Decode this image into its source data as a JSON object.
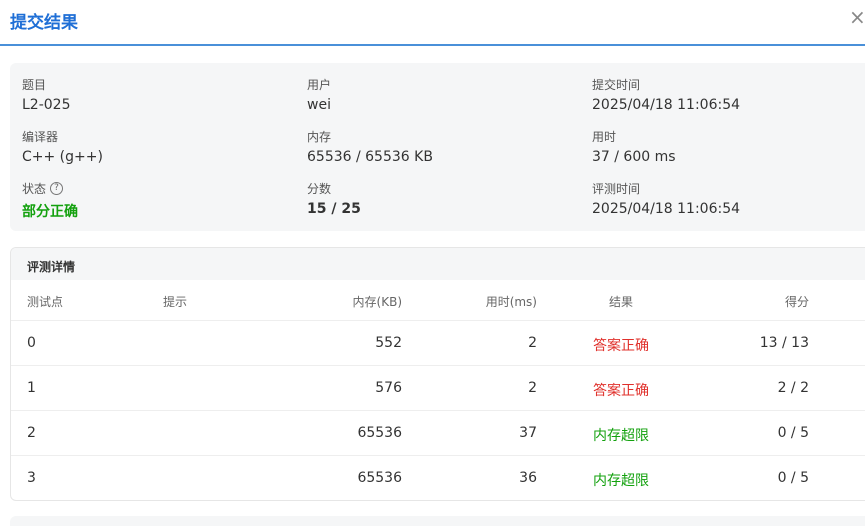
{
  "header": {
    "title": "提交结果",
    "close_glyph": "×"
  },
  "info": {
    "problem_label": "题目",
    "problem": "L2-025",
    "user_label": "用户",
    "user": "wei",
    "submit_time_label": "提交时间",
    "submit_time": "2025/04/18 11:06:54",
    "compiler_label": "编译器",
    "compiler": "C++ (g++)",
    "memory_label": "内存",
    "memory": "65536 / 65536 KB",
    "time_label": "用时",
    "time": "37 / 600 ms",
    "status_label": "状态",
    "status": "部分正确",
    "status_help_icon": "question-circle-icon",
    "score_label": "分数",
    "score": "15 / 25",
    "judge_time_label": "评测时间",
    "judge_time": "2025/04/18 11:06:54"
  },
  "details": {
    "title": "评测详情",
    "columns": {
      "case": "测试点",
      "hint": "提示",
      "memory": "内存(KB)",
      "time": "用时(ms)",
      "result": "结果",
      "score": "得分"
    },
    "rows": [
      {
        "case": "0",
        "hint": "",
        "memory": "552",
        "time": "2",
        "result": "答案正确",
        "score": "13 / 13"
      },
      {
        "case": "1",
        "hint": "",
        "memory": "576",
        "time": "2",
        "result": "答案正确",
        "score": "2 / 2"
      },
      {
        "case": "2",
        "hint": "",
        "memory": "65536",
        "time": "37",
        "result": "内存超限",
        "score": "0 / 5"
      },
      {
        "case": "3",
        "hint": "",
        "memory": "65536",
        "time": "36",
        "result": "内存超限",
        "score": "0 / 5"
      }
    ]
  },
  "colors": {
    "accent": "#1f6fd6",
    "correct": "#e0302b",
    "mle": "#13a10e",
    "partial": "#13a10e"
  }
}
